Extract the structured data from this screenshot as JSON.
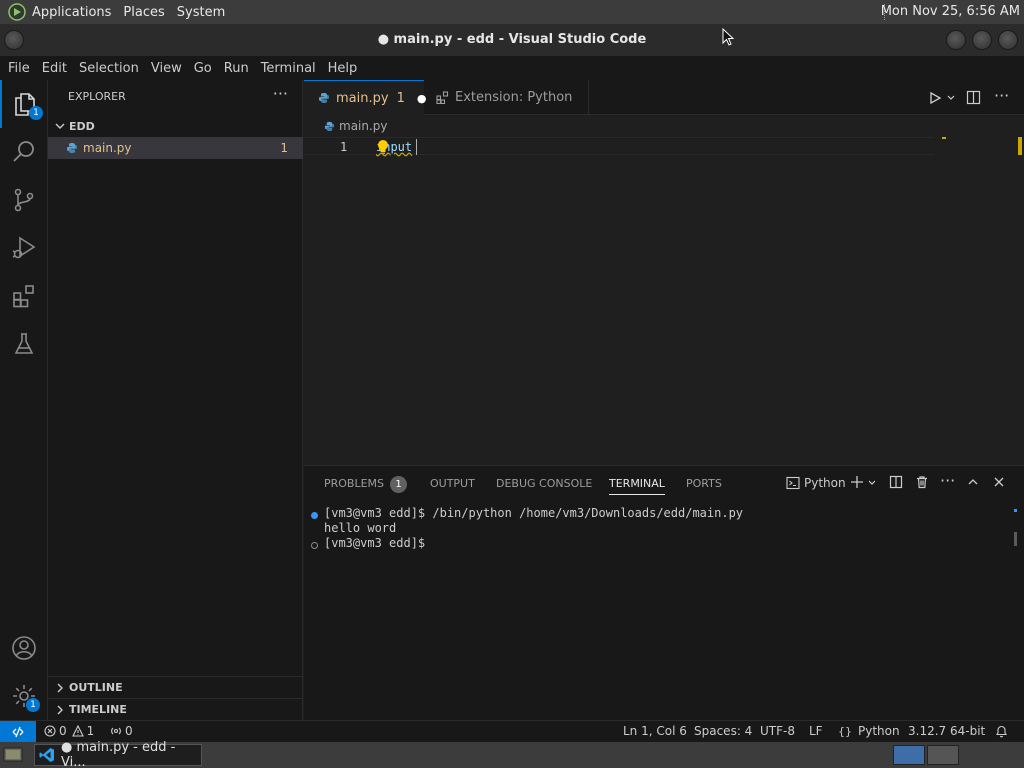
{
  "top_panel": {
    "menus": [
      "Applications",
      "Places",
      "System"
    ],
    "clock": "Mon Nov 25,  6:56 AM"
  },
  "window": {
    "title": "● main.py - edd - Visual Studio Code"
  },
  "menubar": [
    "File",
    "Edit",
    "Selection",
    "View",
    "Go",
    "Run",
    "Terminal",
    "Help"
  ],
  "activity_bar": {
    "explorer_badge": "1",
    "settings_badge": "1"
  },
  "sidebar": {
    "title": "EXPLORER",
    "more": "···",
    "folder": "EDD",
    "file": {
      "name": "main.py",
      "problems": "1"
    },
    "outline": "OUTLINE",
    "timeline": "TIMELINE"
  },
  "tabs": [
    {
      "label": "main.py",
      "problems": "1",
      "modified": "●"
    },
    {
      "label": "Extension: Python"
    }
  ],
  "editor": {
    "breadcrumb": "main.py",
    "lines": [
      {
        "number": "1",
        "text": "input"
      }
    ]
  },
  "panel": {
    "tabs": [
      "PROBLEMS",
      "OUTPUT",
      "DEBUG CONSOLE",
      "TERMINAL",
      "PORTS"
    ],
    "problems_count": "1",
    "active_tab": "TERMINAL",
    "terminal_name": "Python",
    "lines": [
      "[vm3@vm3 edd]$ /bin/python /home/vm3/Downloads/edd/main.py",
      "hello word",
      "[vm3@vm3 edd]$"
    ]
  },
  "statusbar": {
    "errors": "0",
    "warnings": "1",
    "ports": "0",
    "position": "Ln 1, Col 6",
    "spaces": "Spaces: 4",
    "encoding": "UTF-8",
    "eol": "LF",
    "language": "Python",
    "interpreter": "3.12.7 64-bit"
  },
  "taskbar": {
    "task": "● main.py - edd - Vi..."
  },
  "colors": {
    "accent": "#0078d4",
    "modified_file": "#e2c08d",
    "warning": "#cca700"
  }
}
